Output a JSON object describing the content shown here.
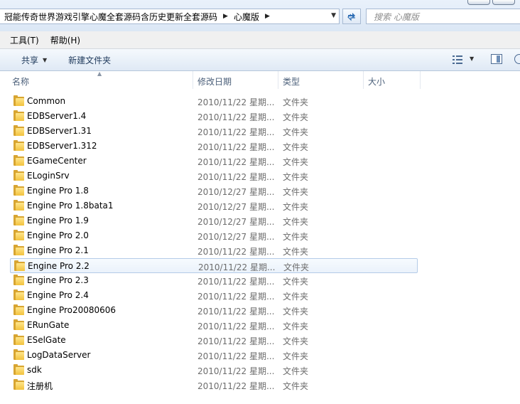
{
  "address": {
    "crumb": "冠能传奇世界游戏引擎心魔全套源码含历史更新全套源码",
    "crumb2": "心魔版"
  },
  "search": {
    "placeholder": "搜索 心魔版"
  },
  "menu": {
    "tools": "工具(T)",
    "help": "帮助(H)"
  },
  "commands": {
    "share": "共享",
    "new_folder": "新建文件夹"
  },
  "columns": {
    "name": "名称",
    "date": "修改日期",
    "type": "类型",
    "size": "大小"
  },
  "files": [
    {
      "name": "Common",
      "date": "2010/11/22 星期...",
      "type": "文件夹"
    },
    {
      "name": "EDBServer1.4",
      "date": "2010/11/22 星期...",
      "type": "文件夹"
    },
    {
      "name": "EDBServer1.31",
      "date": "2010/11/22 星期...",
      "type": "文件夹"
    },
    {
      "name": "EDBServer1.312",
      "date": "2010/11/22 星期...",
      "type": "文件夹"
    },
    {
      "name": "EGameCenter",
      "date": "2010/11/22 星期...",
      "type": "文件夹"
    },
    {
      "name": "ELoginSrv",
      "date": "2010/11/22 星期...",
      "type": "文件夹"
    },
    {
      "name": "Engine Pro 1.8",
      "date": "2010/12/27 星期...",
      "type": "文件夹"
    },
    {
      "name": "Engine Pro 1.8bata1",
      "date": "2010/12/27 星期...",
      "type": "文件夹"
    },
    {
      "name": "Engine Pro 1.9",
      "date": "2010/12/27 星期...",
      "type": "文件夹"
    },
    {
      "name": "Engine Pro 2.0",
      "date": "2010/12/27 星期...",
      "type": "文件夹"
    },
    {
      "name": "Engine Pro 2.1",
      "date": "2010/11/22 星期...",
      "type": "文件夹"
    },
    {
      "name": "Engine Pro 2.2",
      "date": "2010/11/22 星期...",
      "type": "文件夹",
      "selected": true
    },
    {
      "name": "Engine Pro 2.3",
      "date": "2010/11/22 星期...",
      "type": "文件夹"
    },
    {
      "name": "Engine Pro 2.4",
      "date": "2010/11/22 星期...",
      "type": "文件夹"
    },
    {
      "name": "Engine Pro20080606",
      "date": "2010/11/22 星期...",
      "type": "文件夹"
    },
    {
      "name": "ERunGate",
      "date": "2010/11/22 星期...",
      "type": "文件夹"
    },
    {
      "name": "ESelGate",
      "date": "2010/11/22 星期...",
      "type": "文件夹"
    },
    {
      "name": "LogDataServer",
      "date": "2010/11/22 星期...",
      "type": "文件夹"
    },
    {
      "name": "sdk",
      "date": "2010/11/22 星期...",
      "type": "文件夹"
    },
    {
      "name": "注册机",
      "date": "2010/11/22 星期...",
      "type": "文件夹"
    }
  ]
}
